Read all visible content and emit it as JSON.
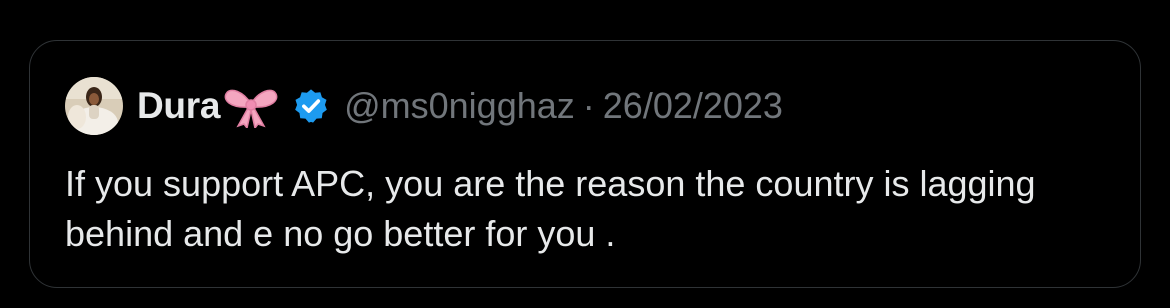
{
  "quoted_tweet": {
    "author": {
      "display_name": "Dura",
      "name_emoji": "ribbon-emoji",
      "verified": true,
      "handle": "@ms0nigghaz",
      "avatar_icon": "avatar-photo"
    },
    "separator": "·",
    "date": "26/02/2023",
    "text": "If you support APC, you are the reason the country is lagging behind and e no go better for you ."
  },
  "colors": {
    "background": "#000000",
    "card_border": "#2f3336",
    "primary_text": "#e7e9ea",
    "secondary_text": "#71767b",
    "verified_blue": "#1d9bf0",
    "ribbon_pink": "#f4a6c0"
  }
}
